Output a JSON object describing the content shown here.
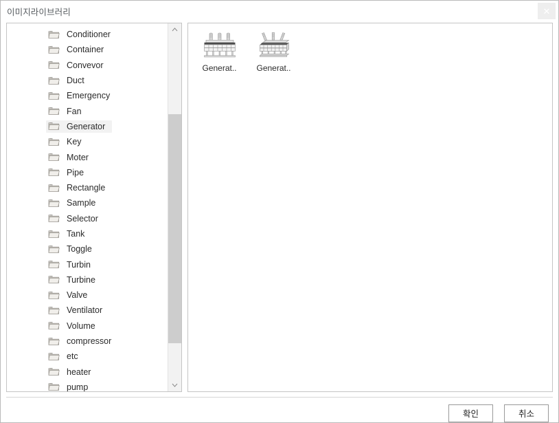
{
  "window": {
    "title": "이미지라이브러리",
    "close_label": "✕",
    "close_icon": "close-icon"
  },
  "tree": {
    "scroll_up_icon": "chevron-up-icon",
    "scroll_down_icon": "chevron-down-icon",
    "selected": "Generator",
    "items": [
      {
        "label": "Conditioner",
        "icon": "folder-icon"
      },
      {
        "label": "Container",
        "icon": "folder-icon"
      },
      {
        "label": "Convevor",
        "icon": "folder-icon"
      },
      {
        "label": "Duct",
        "icon": "folder-icon"
      },
      {
        "label": "Emergency",
        "icon": "folder-icon"
      },
      {
        "label": "Fan",
        "icon": "folder-icon"
      },
      {
        "label": "Generator",
        "icon": "folder-icon"
      },
      {
        "label": "Key",
        "icon": "folder-icon"
      },
      {
        "label": "Moter",
        "icon": "folder-icon"
      },
      {
        "label": "Pipe",
        "icon": "folder-icon"
      },
      {
        "label": "Rectangle",
        "icon": "folder-icon"
      },
      {
        "label": "Sample",
        "icon": "folder-icon"
      },
      {
        "label": "Selector",
        "icon": "folder-icon"
      },
      {
        "label": "Tank",
        "icon": "folder-icon"
      },
      {
        "label": "Toggle",
        "icon": "folder-icon"
      },
      {
        "label": "Turbin",
        "icon": "folder-icon"
      },
      {
        "label": "Turbine",
        "icon": "folder-icon"
      },
      {
        "label": "Valve",
        "icon": "folder-icon"
      },
      {
        "label": "Ventilator",
        "icon": "folder-icon"
      },
      {
        "label": "Volume",
        "icon": "folder-icon"
      },
      {
        "label": "compressor",
        "icon": "folder-icon"
      },
      {
        "label": "etc",
        "icon": "folder-icon"
      },
      {
        "label": "heater",
        "icon": "folder-icon"
      },
      {
        "label": "pump",
        "icon": "folder-icon"
      }
    ]
  },
  "thumbnails": {
    "items": [
      {
        "label": "Generat..",
        "icon": "generator-front-icon"
      },
      {
        "label": "Generat..",
        "icon": "generator-perspective-icon"
      }
    ]
  },
  "footer": {
    "ok_label": "확인",
    "cancel_label": "취소"
  },
  "colors": {
    "panel_border": "#c4c4c4",
    "selection": "#f2f2f2",
    "scrollbar_track": "#f2f2f2",
    "scrollbar_thumb": "#cdcdcd",
    "title_text": "#555a5e"
  }
}
